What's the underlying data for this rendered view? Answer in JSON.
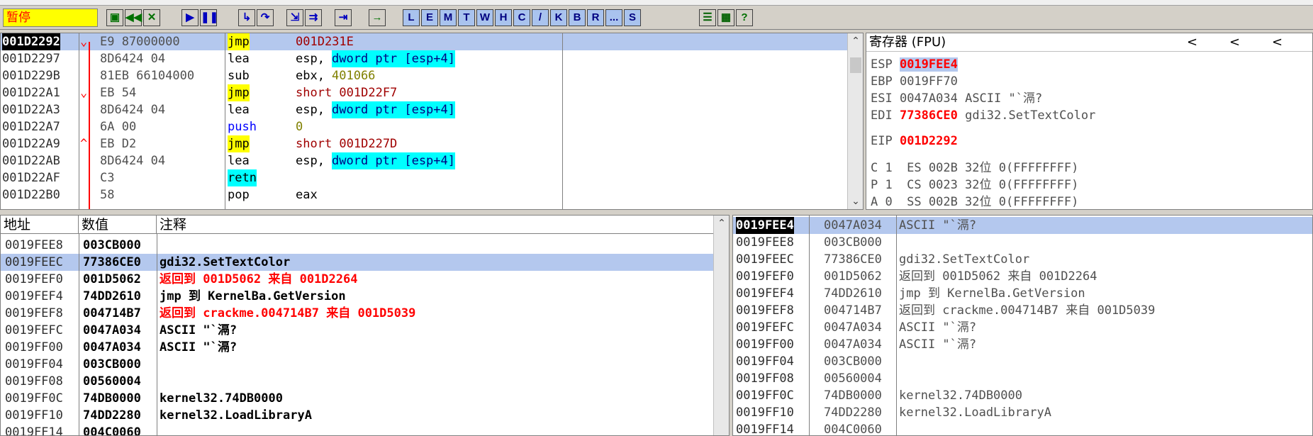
{
  "toolbar": {
    "status": "暂停",
    "letter_buttons": [
      "L",
      "E",
      "M",
      "T",
      "W",
      "H",
      "C",
      "/",
      "K",
      "B",
      "R",
      "...",
      "S"
    ]
  },
  "disasm": {
    "rows": [
      {
        "addr": "001D2292",
        "arrow": "⌄",
        "hex": "E9 87000000",
        "mnemonic": "jmp",
        "operand": "001D231E",
        "current": true
      },
      {
        "addr": "001D2297",
        "arrow": "",
        "hex": "8D6424 04",
        "mnemonic": "lea",
        "operand_pre": "esp, ",
        "operand_mem": "dword ptr [esp+4]"
      },
      {
        "addr": "001D229B",
        "arrow": "",
        "hex": "81EB 66104000",
        "mnemonic": "sub",
        "operand_pre": "ebx, ",
        "operand_imm": "401066"
      },
      {
        "addr": "001D22A1",
        "arrow": "⌄",
        "hex": "EB 54",
        "mnemonic": "jmp",
        "operand": "short 001D22F7"
      },
      {
        "addr": "001D22A3",
        "arrow": "",
        "hex": "8D6424 04",
        "mnemonic": "lea",
        "operand_pre": "esp, ",
        "operand_mem": "dword ptr [esp+4]"
      },
      {
        "addr": "001D22A7",
        "arrow": "",
        "hex": "6A 00",
        "mnemonic": "push",
        "operand_imm": "0"
      },
      {
        "addr": "001D22A9",
        "arrow": "^",
        "hex": "EB D2",
        "mnemonic": "jmp",
        "operand": "short 001D227D"
      },
      {
        "addr": "001D22AB",
        "arrow": "",
        "hex": "8D6424 04",
        "mnemonic": "lea",
        "operand_pre": "esp, ",
        "operand_mem": "dword ptr [esp+4]"
      },
      {
        "addr": "001D22AF",
        "arrow": "",
        "hex": "C3",
        "mnemonic": "retn",
        "operand": ""
      },
      {
        "addr": "001D22B0",
        "arrow": "",
        "hex": "58",
        "mnemonic": "pop",
        "operand": "eax"
      }
    ]
  },
  "registers": {
    "title": "寄存器 (FPU)",
    "nav": [
      "<",
      "<",
      "<"
    ],
    "lines": [
      {
        "name": "ESP ",
        "value": "0019FEE4",
        "style": "sel",
        "extra": ""
      },
      {
        "name": "EBP ",
        "value": "0019FF70",
        "style": "plain",
        "extra": ""
      },
      {
        "name": "ESI ",
        "value": "0047A034",
        "style": "plain",
        "extra": " ASCII \"`滆?"
      },
      {
        "name": "EDI ",
        "value": "77386CE0",
        "style": "red",
        "extra": " gdi32.SetTextColor"
      },
      {
        "name": "EIP ",
        "value": "001D2292",
        "style": "red",
        "extra": ""
      },
      {
        "name": "C 1  ES 002B 32位 0(FFFFFFFF)",
        "value": "",
        "style": "plain",
        "extra": ""
      },
      {
        "name": "P 1  CS 0023 32位 0(FFFFFFFF)",
        "value": "",
        "style": "plain",
        "extra": ""
      },
      {
        "name": "A 0  SS 002B 32位 0(FFFFFFFF)",
        "value": "",
        "style": "plain",
        "extra": ""
      }
    ]
  },
  "dump": {
    "headers": {
      "address": "地址",
      "value": "数值",
      "comment": "注释"
    },
    "rows": [
      {
        "addr": "0019FEE8",
        "val": "003CB000",
        "comment": ""
      },
      {
        "addr": "0019FEEC",
        "val": "77386CE0",
        "comment": "gdi32.SetTextColor",
        "selected": true
      },
      {
        "addr": "0019FEF0",
        "val": "001D5062",
        "comment_red": "返回到 001D5062 来自 001D2264"
      },
      {
        "addr": "0019FEF4",
        "val": "74DD2610",
        "comment": "jmp 到 KernelBa.GetVersion"
      },
      {
        "addr": "0019FEF8",
        "val": "004714B7",
        "comment_red": "返回到 crackme.004714B7 来自 001D5039"
      },
      {
        "addr": "0019FEFC",
        "val": "0047A034",
        "comment": "ASCII \"`滆?"
      },
      {
        "addr": "0019FF00",
        "val": "0047A034",
        "comment": "ASCII \"`滆?"
      },
      {
        "addr": "0019FF04",
        "val": "003CB000",
        "comment": ""
      },
      {
        "addr": "0019FF08",
        "val": "00560004",
        "comment": ""
      },
      {
        "addr": "0019FF0C",
        "val": "74DB0000",
        "comment": "kernel32.74DB0000"
      },
      {
        "addr": "0019FF10",
        "val": "74DD2280",
        "comment": "kernel32.LoadLibraryA"
      },
      {
        "addr": "0019FF14",
        "val": "004C0060",
        "comment": ""
      }
    ]
  },
  "stack": {
    "rows": [
      {
        "addr": "0019FEE4",
        "val": "0047A034",
        "comment": "ASCII \"`滆?",
        "selected": true
      },
      {
        "addr": "0019FEE8",
        "val": "003CB000",
        "comment": ""
      },
      {
        "addr": "0019FEEC",
        "val": "77386CE0",
        "comment": "gdi32.SetTextColor"
      },
      {
        "addr": "0019FEF0",
        "val": "001D5062",
        "comment": "返回到 001D5062 来自 001D2264"
      },
      {
        "addr": "0019FEF4",
        "val": "74DD2610",
        "comment": "jmp 到 KernelBa.GetVersion"
      },
      {
        "addr": "0019FEF8",
        "val": "004714B7",
        "comment": "返回到 crackme.004714B7 来自 001D5039"
      },
      {
        "addr": "0019FEFC",
        "val": "0047A034",
        "comment": "ASCII \"`滆?"
      },
      {
        "addr": "0019FF00",
        "val": "0047A034",
        "comment": "ASCII \"`滆?"
      },
      {
        "addr": "0019FF04",
        "val": "003CB000",
        "comment": ""
      },
      {
        "addr": "0019FF08",
        "val": "00560004",
        "comment": ""
      },
      {
        "addr": "0019FF0C",
        "val": "74DB0000",
        "comment": "kernel32.74DB0000"
      },
      {
        "addr": "0019FF10",
        "val": "74DD2280",
        "comment": "kernel32.LoadLibraryA"
      },
      {
        "addr": "0019FF14",
        "val": "004C0060",
        "comment": ""
      }
    ]
  },
  "icons": [
    "open-icon",
    "restart-icon",
    "close-icon",
    "run-icon",
    "pause-icon",
    "step-into-icon",
    "step-over-icon",
    "trace-into-icon",
    "trace-over-icon",
    "execute-till-return-icon",
    "goto-icon",
    "options-icon",
    "appearance-icon",
    "help-icon"
  ]
}
